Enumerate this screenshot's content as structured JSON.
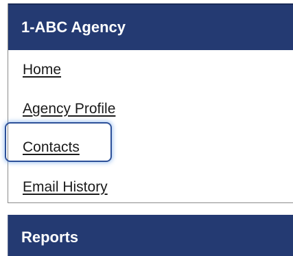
{
  "agency_panel": {
    "title": "1-ABC Agency",
    "links": [
      {
        "label": "Home"
      },
      {
        "label": "Agency Profile"
      },
      {
        "label": "Contacts",
        "focused": true
      },
      {
        "label": "Email History"
      }
    ]
  },
  "reports_panel": {
    "title": "Reports"
  },
  "colors": {
    "header_bg": "#243a72",
    "header_text": "#ffffff",
    "link_text": "#1a1a1a",
    "focus_ring": "#2b4f98"
  }
}
